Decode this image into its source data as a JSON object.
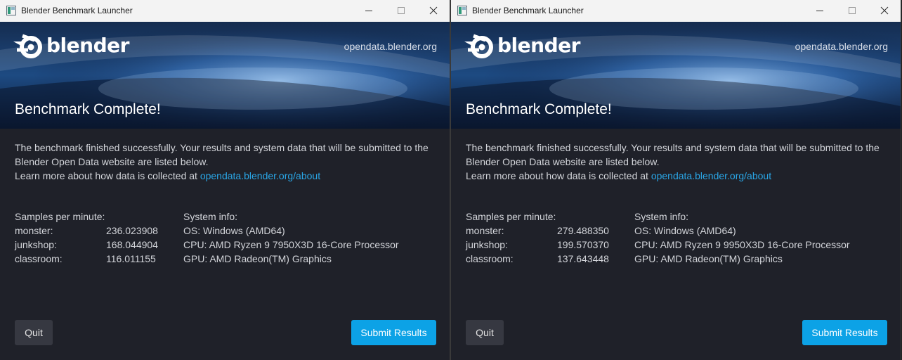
{
  "windows": [
    {
      "title": "Blender Benchmark Launcher",
      "logo_text": "blender",
      "site_link": "opendata.blender.org",
      "heading": "Benchmark Complete!",
      "paragraph_line1": "The benchmark finished successfully. Your results and system data that will be submitted to the",
      "paragraph_line2": "Blender Open Data website are listed below.",
      "learn_prefix": "Learn more about how data is collected at ",
      "learn_link": "opendata.blender.org/about",
      "samples_header": "Samples per minute:",
      "system_header": "System info:",
      "rows": [
        {
          "name": "monster:",
          "value": "236.023908",
          "info": "OS: Windows (AMD64)"
        },
        {
          "name": "junkshop:",
          "value": "168.044904",
          "info": "CPU: AMD Ryzen 9 7950X3D 16-Core Processor"
        },
        {
          "name": "classroom:",
          "value": "116.011155",
          "info": "GPU: AMD Radeon(TM) Graphics"
        }
      ],
      "quit_label": "Quit",
      "submit_label": "Submit Results"
    },
    {
      "title": "Blender Benchmark Launcher",
      "logo_text": "blender",
      "site_link": "opendata.blender.org",
      "heading": "Benchmark Complete!",
      "paragraph_line1": "The benchmark finished successfully. Your results and system data that will be submitted to the",
      "paragraph_line2": "Blender Open Data website are listed below.",
      "learn_prefix": "Learn more about how data is collected at ",
      "learn_link": "opendata.blender.org/about",
      "samples_header": "Samples per minute:",
      "system_header": "System info:",
      "rows": [
        {
          "name": "monster:",
          "value": "279.488350",
          "info": "OS: Windows (AMD64)"
        },
        {
          "name": "junkshop:",
          "value": "199.570370",
          "info": "CPU: AMD Ryzen 9 9950X3D 16-Core Processor"
        },
        {
          "name": "classroom:",
          "value": "137.643448",
          "info": "GPU: AMD Radeon(TM) Graphics"
        }
      ],
      "quit_label": "Quit",
      "submit_label": "Submit Results"
    }
  ],
  "colors": {
    "accent": "#0ca2e6",
    "link": "#2aa6e6",
    "background": "#1f2129"
  }
}
